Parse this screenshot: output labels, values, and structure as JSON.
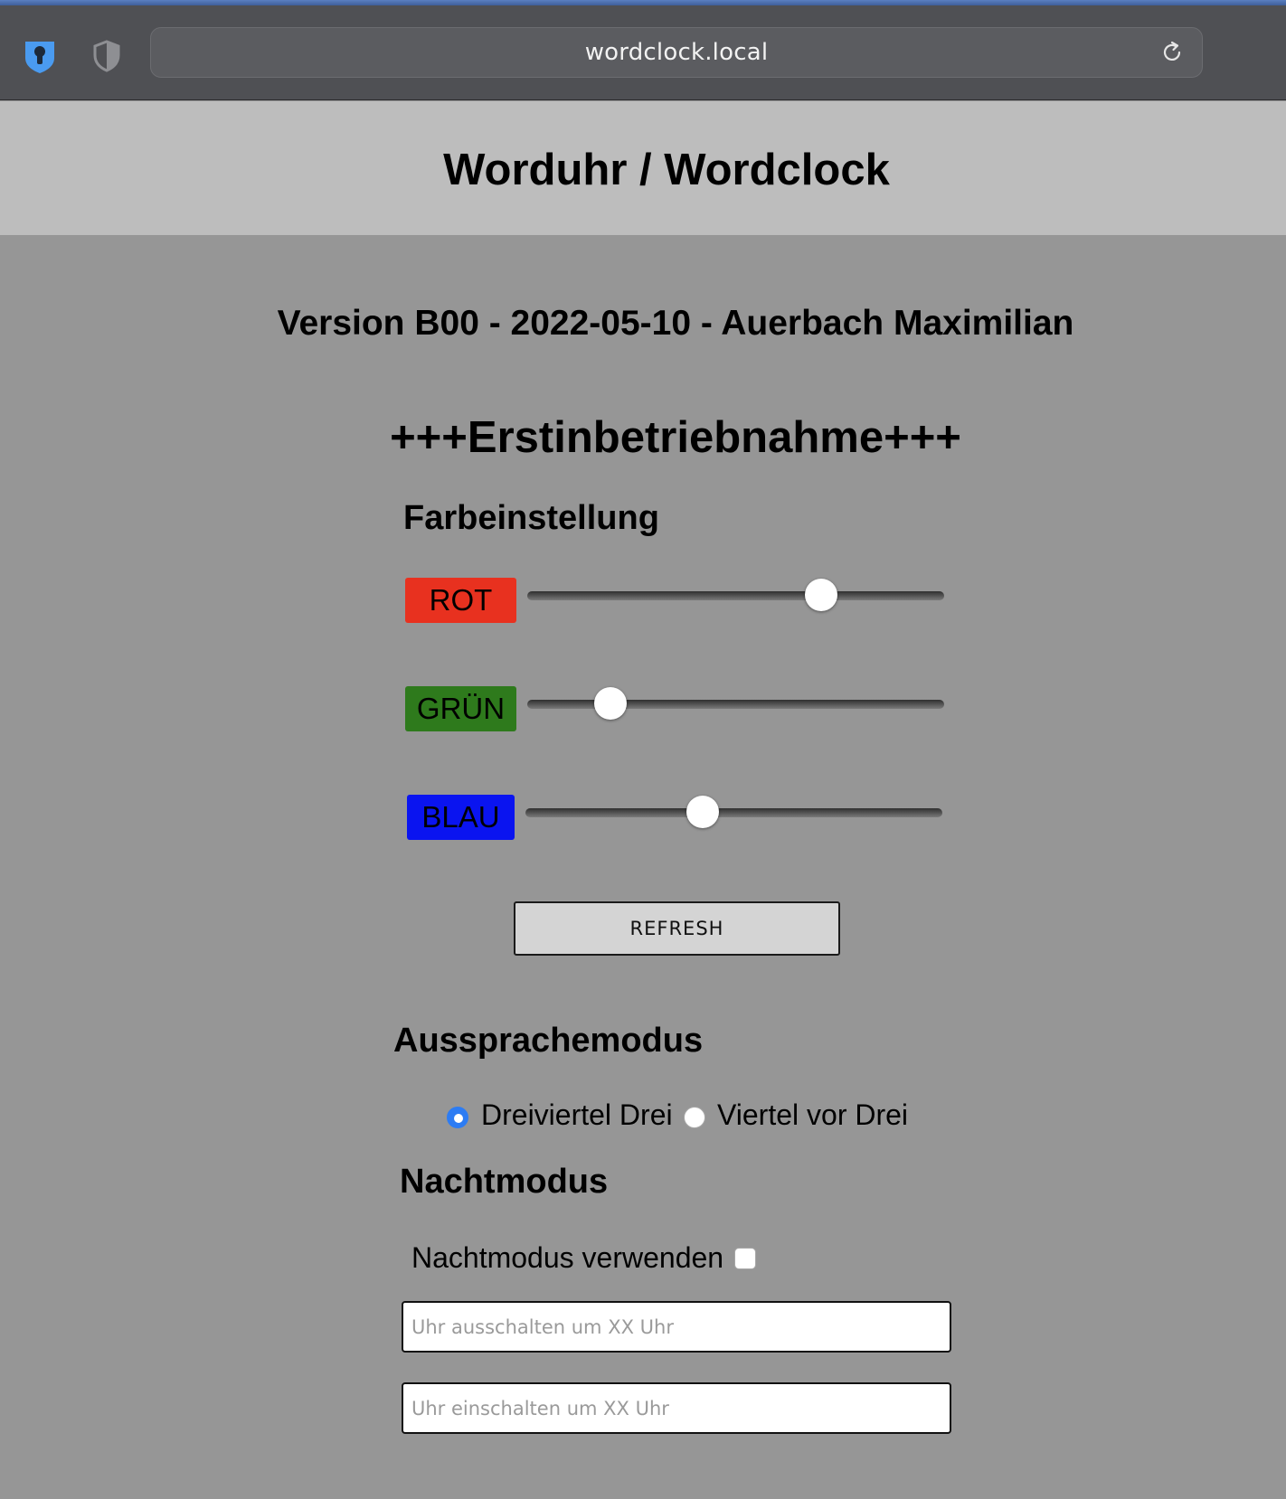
{
  "browser": {
    "url": "wordclock.local",
    "icons": {
      "password_manager": "password-manager-icon",
      "privacy_shield": "shield-icon",
      "reload": "reload-icon"
    }
  },
  "header": {
    "title": "Worduhr / Wordclock"
  },
  "main": {
    "version": "Version B00 - 2022-05-10 - Auerbach Maximilian",
    "section_title": "+++Erstinbetriebnahme+++",
    "color_settings": {
      "heading": "Farbeinstellung",
      "sliders": [
        {
          "label": "ROT",
          "color": "#e8311f",
          "value_fraction": 0.705
        },
        {
          "label": "GRÜN",
          "color": "#2e7a1c",
          "value_fraction": 0.2
        },
        {
          "label": "BLAU",
          "color": "#0a14f0",
          "value_fraction": 0.425
        }
      ],
      "refresh_label": "REFRESH"
    },
    "pronunciation": {
      "heading": "Aussprachemodus",
      "options": [
        {
          "label": "Dreiviertel Drei",
          "checked": true
        },
        {
          "label": "Viertel vor Drei",
          "checked": false
        }
      ]
    },
    "night_mode": {
      "heading": "Nachtmodus",
      "use_label": "Nachtmodus verwenden",
      "use_checked": false,
      "off_placeholder": "Uhr ausschalten um XX Uhr",
      "on_placeholder": "Uhr einschalten um XX Uhr"
    }
  },
  "colors": {
    "page_background": "#969696",
    "header_background": "#bdbdbd",
    "toolbar_background": "#4f5054",
    "radio_accent": "#2d7cf3"
  }
}
